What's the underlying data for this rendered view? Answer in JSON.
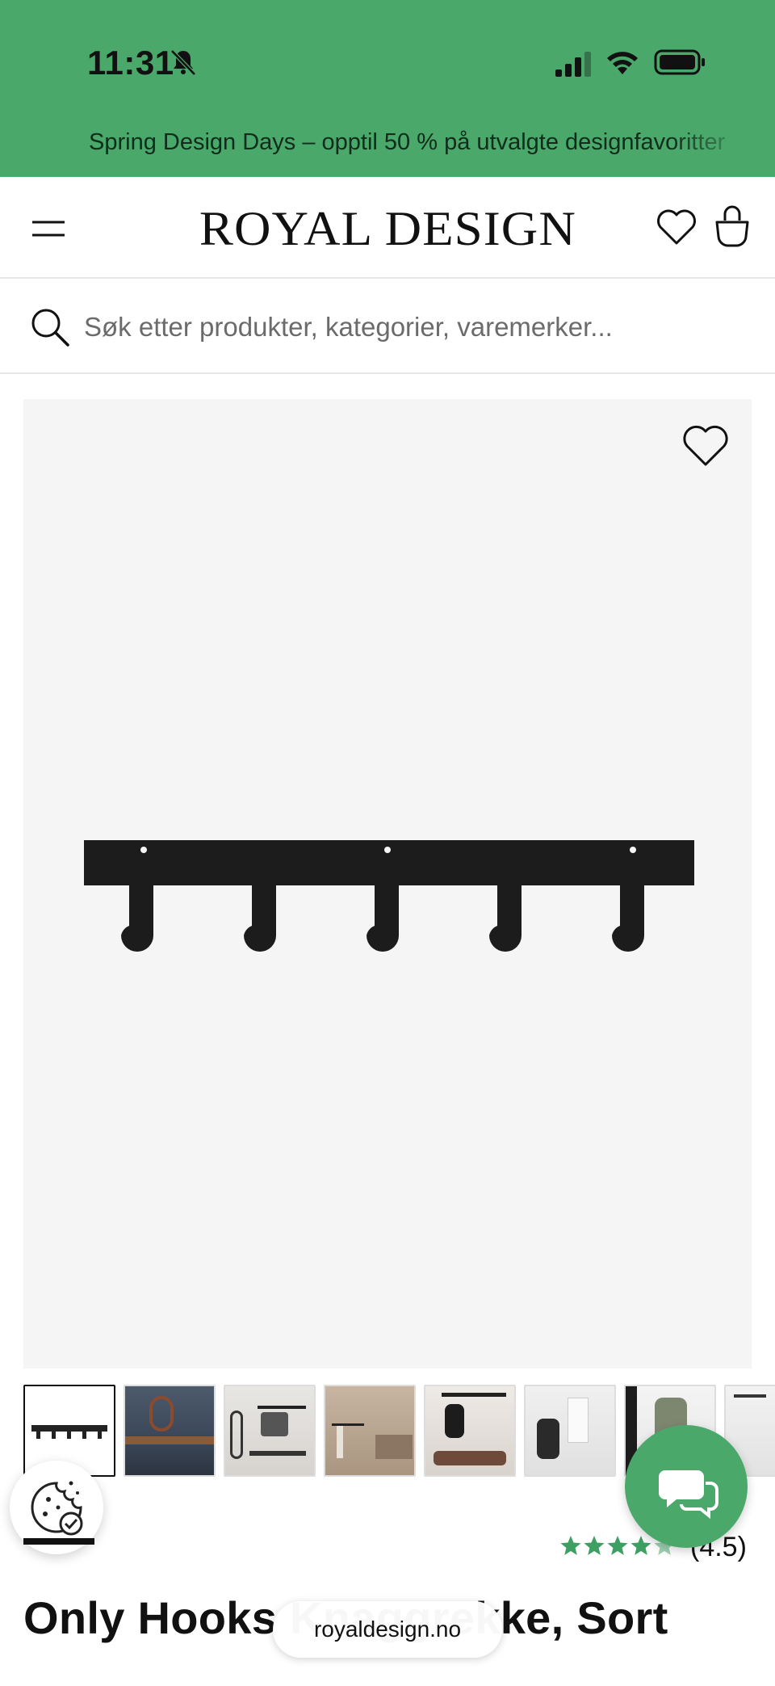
{
  "status_bar": {
    "time": "11:31"
  },
  "promo_banner": {
    "text": "Spring Design Days – opptil 50 % på utvalgte designfavoritter"
  },
  "header": {
    "logo": "ROYAL DESIGN"
  },
  "search": {
    "placeholder": "Søk etter produkter, kategorier, varemerker..."
  },
  "product": {
    "title": "Only Hooks Knaggrekke, Sort",
    "rating": "(4.5)",
    "rating_value": 4.5,
    "rating_max": 5
  },
  "browser": {
    "url": "royaldesign.no"
  },
  "colors": {
    "brand_green": "#4aa86b",
    "star_green": "#3e9f63"
  },
  "icons": {
    "menu": "hamburger-icon",
    "wishlist": "heart-icon",
    "cart": "bag-icon",
    "search": "search-icon",
    "cookie": "cookie-icon",
    "chat": "chat-icon"
  }
}
